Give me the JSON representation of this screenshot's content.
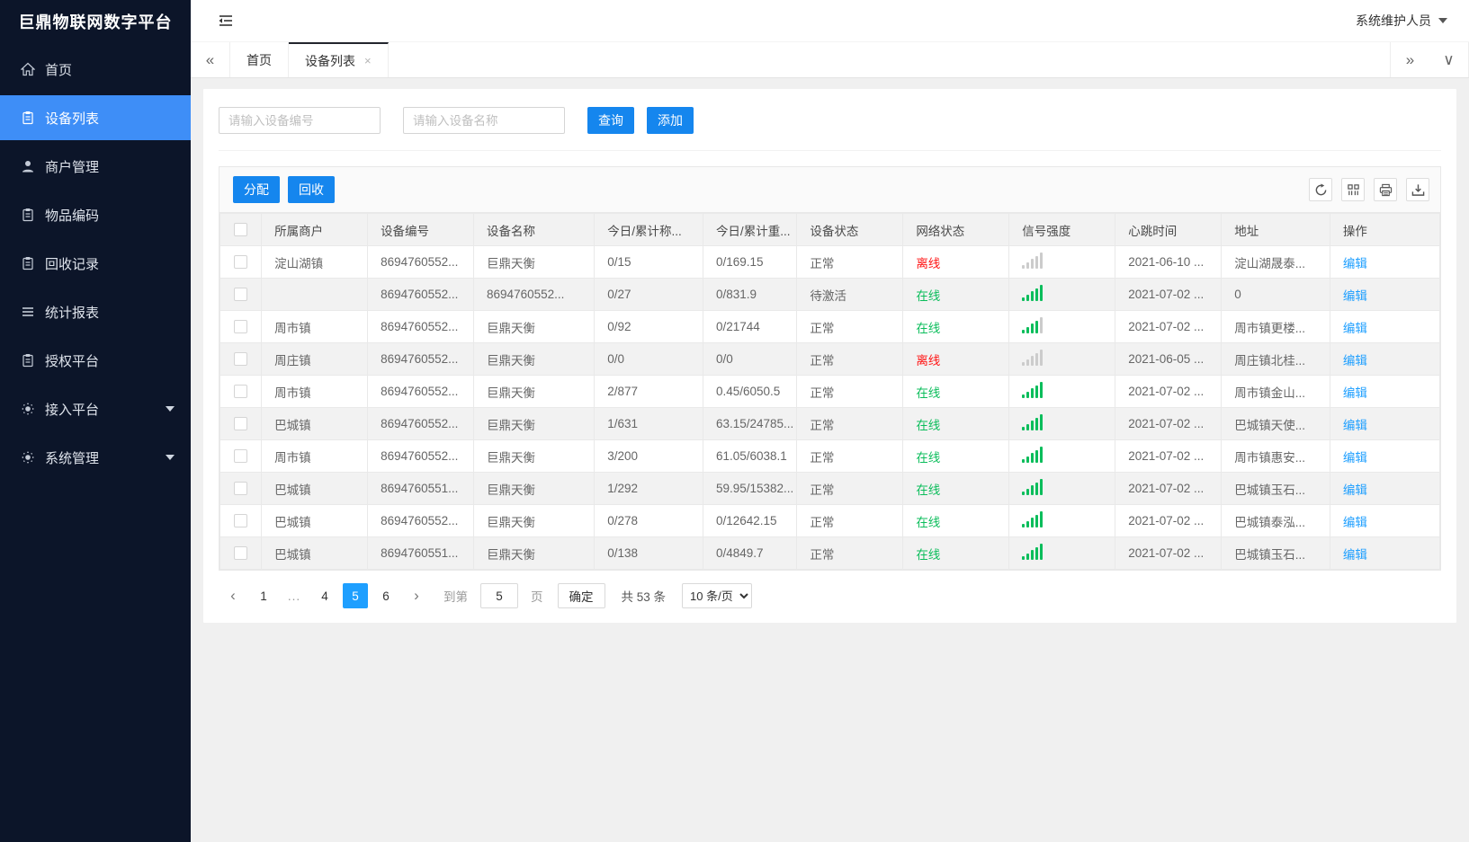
{
  "colors": {
    "sidebar_bg": "#0c1529",
    "sidebar_active": "#3e8ef7",
    "button_blue": "#1586ee",
    "link_blue": "#1e9fff",
    "offline_red": "#ff1414",
    "online_green": "#0bbd5b",
    "signal_gray": "#cccccc"
  },
  "sidebar": {
    "title": "巨鼎物联网数字平台",
    "items": [
      {
        "label": "首页",
        "icon": "home-icon",
        "active": false,
        "caret": false
      },
      {
        "label": "设备列表",
        "icon": "clipboard-icon",
        "active": true,
        "caret": false
      },
      {
        "label": "商户管理",
        "icon": "user-icon",
        "active": false,
        "caret": false
      },
      {
        "label": "物品编码",
        "icon": "clipboard-icon",
        "active": false,
        "caret": false
      },
      {
        "label": "回收记录",
        "icon": "clipboard-icon",
        "active": false,
        "caret": false
      },
      {
        "label": "统计报表",
        "icon": "lines-icon",
        "active": false,
        "caret": false
      },
      {
        "label": "授权平台",
        "icon": "clipboard-icon",
        "active": false,
        "caret": false
      },
      {
        "label": "接入平台",
        "icon": "gear-icon",
        "active": false,
        "caret": true
      },
      {
        "label": "系统管理",
        "icon": "gear-icon",
        "active": false,
        "caret": true
      }
    ]
  },
  "header": {
    "user": "系统维护人员"
  },
  "tabs": {
    "collapse_left": "«",
    "collapse_right": "»",
    "dropdown": "∨",
    "close": "×",
    "items": [
      {
        "label": "首页",
        "active": false,
        "closable": false
      },
      {
        "label": "设备列表",
        "active": true,
        "closable": true
      }
    ]
  },
  "search": {
    "device_no_placeholder": "请输入设备编号",
    "device_name_placeholder": "请输入设备名称",
    "query_label": "查询",
    "add_label": "添加"
  },
  "toolbar": {
    "assign_label": "分配",
    "recycle_label": "回收",
    "icons": [
      "refresh-icon",
      "columns-icon",
      "printer-icon",
      "download-icon"
    ]
  },
  "table": {
    "headers": [
      "所属商户",
      "设备编号",
      "设备名称",
      "今日/累计称...",
      "今日/累计重...",
      "设备状态",
      "网络状态",
      "信号强度",
      "心跳时间",
      "地址",
      "操作"
    ],
    "edit_label": "编辑",
    "rows": [
      {
        "merchant": "淀山湖镇",
        "device_no": "8694760552...",
        "device_name": "巨鼎天衡",
        "count": "0/15",
        "weight": "0/169.15",
        "device_status": "正常",
        "network_status": "离线",
        "online": false,
        "signal_green": 0,
        "heartbeat": "2021-06-10 ...",
        "address": "淀山湖晟泰..."
      },
      {
        "merchant": "",
        "device_no": "8694760552...",
        "device_name": "8694760552...",
        "count": "0/27",
        "weight": "0/831.9",
        "device_status": "待激活",
        "network_status": "在线",
        "online": true,
        "signal_green": 5,
        "heartbeat": "2021-07-02 ...",
        "address": "0"
      },
      {
        "merchant": "周市镇",
        "device_no": "8694760552...",
        "device_name": "巨鼎天衡",
        "count": "0/92",
        "weight": "0/21744",
        "device_status": "正常",
        "network_status": "在线",
        "online": true,
        "signal_green": 4,
        "heartbeat": "2021-07-02 ...",
        "address": "周市镇更楼..."
      },
      {
        "merchant": "周庄镇",
        "device_no": "8694760552...",
        "device_name": "巨鼎天衡",
        "count": "0/0",
        "weight": "0/0",
        "device_status": "正常",
        "network_status": "离线",
        "online": false,
        "signal_green": 0,
        "heartbeat": "2021-06-05 ...",
        "address": "周庄镇北桂..."
      },
      {
        "merchant": "周市镇",
        "device_no": "8694760552...",
        "device_name": "巨鼎天衡",
        "count": "2/877",
        "weight": "0.45/6050.5",
        "device_status": "正常",
        "network_status": "在线",
        "online": true,
        "signal_green": 5,
        "heartbeat": "2021-07-02 ...",
        "address": "周市镇金山..."
      },
      {
        "merchant": "巴城镇",
        "device_no": "8694760552...",
        "device_name": "巨鼎天衡",
        "count": "1/631",
        "weight": "63.15/24785...",
        "device_status": "正常",
        "network_status": "在线",
        "online": true,
        "signal_green": 5,
        "heartbeat": "2021-07-02 ...",
        "address": "巴城镇天使..."
      },
      {
        "merchant": "周市镇",
        "device_no": "8694760552...",
        "device_name": "巨鼎天衡",
        "count": "3/200",
        "weight": "61.05/6038.1",
        "device_status": "正常",
        "network_status": "在线",
        "online": true,
        "signal_green": 5,
        "heartbeat": "2021-07-02 ...",
        "address": "周市镇惠安..."
      },
      {
        "merchant": "巴城镇",
        "device_no": "8694760551...",
        "device_name": "巨鼎天衡",
        "count": "1/292",
        "weight": "59.95/15382...",
        "device_status": "正常",
        "network_status": "在线",
        "online": true,
        "signal_green": 5,
        "heartbeat": "2021-07-02 ...",
        "address": "巴城镇玉石..."
      },
      {
        "merchant": "巴城镇",
        "device_no": "8694760552...",
        "device_name": "巨鼎天衡",
        "count": "0/278",
        "weight": "0/12642.15",
        "device_status": "正常",
        "network_status": "在线",
        "online": true,
        "signal_green": 5,
        "heartbeat": "2021-07-02 ...",
        "address": "巴城镇泰泓..."
      },
      {
        "merchant": "巴城镇",
        "device_no": "8694760551...",
        "device_name": "巨鼎天衡",
        "count": "0/138",
        "weight": "0/4849.7",
        "device_status": "正常",
        "network_status": "在线",
        "online": true,
        "signal_green": 5,
        "heartbeat": "2021-07-02 ...",
        "address": "巴城镇玉石..."
      }
    ]
  },
  "pagination": {
    "prev": "‹",
    "next": "›",
    "pages": [
      "1",
      "...",
      "4",
      "5",
      "6"
    ],
    "active_page": "5",
    "jump_prefix": "到第",
    "jump_value": "5",
    "jump_unit": "页",
    "confirm_label": "确定",
    "total_label": "共 53 条",
    "page_size_label": "10 条/页"
  }
}
